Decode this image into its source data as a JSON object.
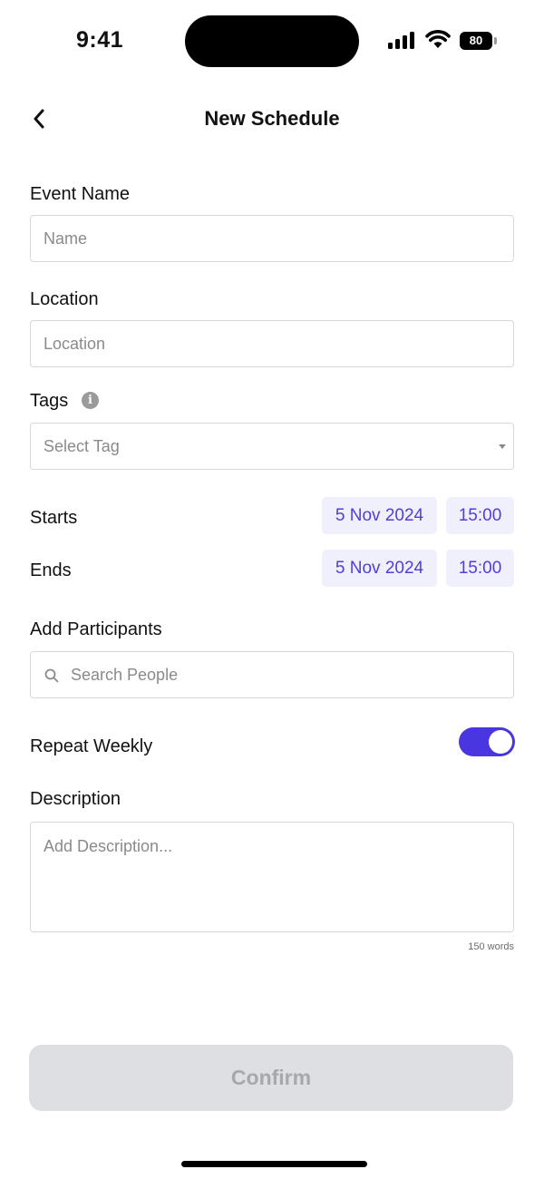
{
  "status_bar": {
    "time": "9:41",
    "battery": "80"
  },
  "nav": {
    "title": "New Schedule"
  },
  "form": {
    "event_name": {
      "label": "Event Name",
      "placeholder": "Name"
    },
    "location": {
      "label": "Location",
      "placeholder": "Location"
    },
    "tags": {
      "label": "Tags",
      "placeholder": "Select Tag",
      "info_glyph": "i"
    },
    "starts": {
      "label": "Starts",
      "date": "5 Nov 2024",
      "time": "15:00"
    },
    "ends": {
      "label": "Ends",
      "date": "5 Nov 2024",
      "time": "15:00"
    },
    "participants": {
      "label": "Add Participants",
      "placeholder": "Search People"
    },
    "repeat_weekly": {
      "label": "Repeat Weekly",
      "enabled": true
    },
    "description": {
      "label": "Description",
      "placeholder": "Add Description...",
      "counter": "150 words"
    }
  },
  "confirm": {
    "label": "Confirm"
  },
  "colors": {
    "accent": "#4a36e0",
    "chip_bg": "#f0effc",
    "chip_text": "#4f3fd6",
    "button_disabled": "#dedfe2"
  },
  "icons": [
    "back-chevron-icon",
    "info-icon",
    "search-icon",
    "chevron-down-icon",
    "signal-icon",
    "wifi-icon",
    "battery-icon"
  ]
}
